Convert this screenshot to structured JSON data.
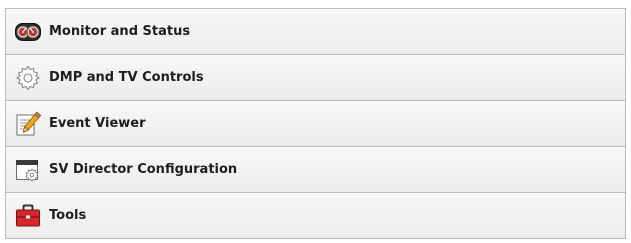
{
  "menu": {
    "items": [
      {
        "label": "Monitor and Status",
        "icon": "gauge-icon"
      },
      {
        "label": "DMP and TV Controls",
        "icon": "gear-icon"
      },
      {
        "label": "Event Viewer",
        "icon": "notepad-pencil-icon"
      },
      {
        "label": "SV Director Configuration",
        "icon": "window-gear-icon"
      },
      {
        "label": "Tools",
        "icon": "toolbox-icon"
      }
    ]
  },
  "colors": {
    "item_bg_top": "#f8f8f8",
    "item_bg_bottom": "#ececec",
    "border": "#b9b9b9",
    "text": "#1e1e1e",
    "toolbox_red": "#d9262b",
    "pencil_orange": "#f2a21b"
  }
}
